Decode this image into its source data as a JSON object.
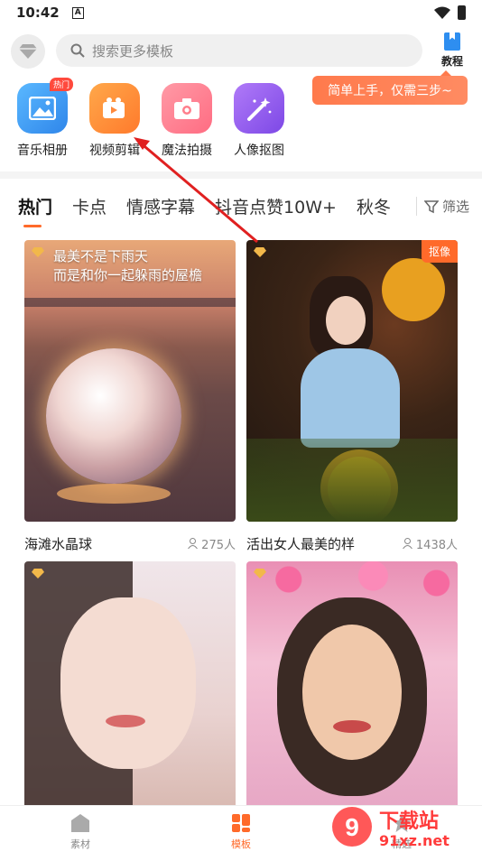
{
  "status": {
    "time": "10:42",
    "a_icon": "A"
  },
  "search": {
    "placeholder": "搜索更多模板"
  },
  "tutorial": {
    "label": "教程"
  },
  "tip": "简单上手，仅需三步~",
  "features": [
    {
      "label": "音乐相册",
      "badge": "热门",
      "color": "#3aa0f5",
      "icon": "photo-icon"
    },
    {
      "label": "视频剪辑",
      "badge": "",
      "color": "#ff8a3c",
      "icon": "video-icon"
    },
    {
      "label": "魔法拍摄",
      "badge": "",
      "color": "#ff7f8c",
      "icon": "camera-icon"
    },
    {
      "label": "人像抠图",
      "badge": "",
      "color": "#9a5cf0",
      "icon": "magic-wand-icon"
    }
  ],
  "tabs": [
    "热门",
    "卡点",
    "情感字幕",
    "抖音点赞10W+",
    "秋冬"
  ],
  "filter": "筛选",
  "cards": [
    {
      "title": "海滩水晶球",
      "count": "275人",
      "overlay": [
        "最美不是下雨天",
        "而是和你一起躲雨的屋檐"
      ],
      "badge": ""
    },
    {
      "title": "活出女人最美的样",
      "count": "1438人",
      "overlay": [],
      "badge": "抠像"
    },
    {
      "title": "",
      "count": "",
      "overlay": [],
      "badge": ""
    },
    {
      "title": "",
      "count": "",
      "overlay": [],
      "badge": ""
    }
  ],
  "nav": [
    {
      "label": "素材",
      "active": false
    },
    {
      "label": "模板",
      "active": true
    },
    {
      "label": "精选",
      "active": false
    }
  ],
  "watermark": {
    "text1": "下载站",
    "text2": "91xz.net"
  },
  "colors": {
    "accent": "#ff6a2a",
    "tip": "#ff7a4c",
    "arrow": "#e02020"
  }
}
